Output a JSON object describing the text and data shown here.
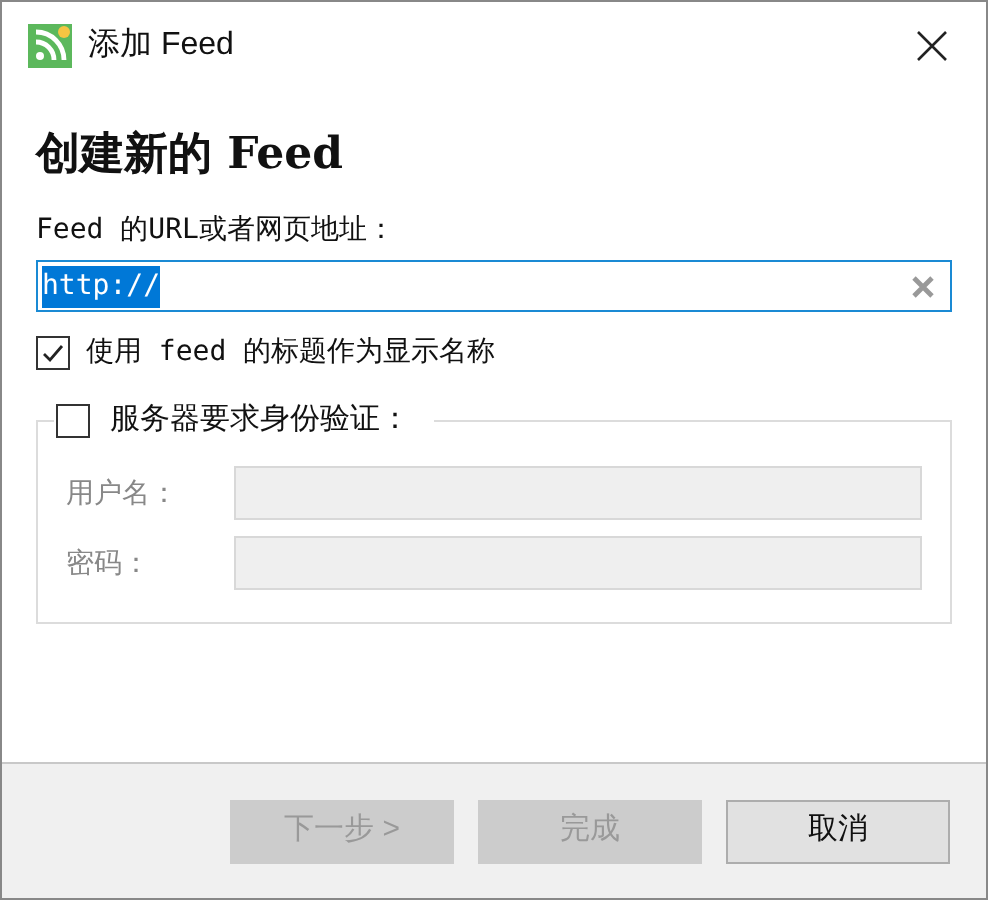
{
  "window": {
    "title": "添加 Feed"
  },
  "heading": "创建新的 Feed",
  "url": {
    "label": "Feed 的URL或者网页地址：",
    "value": "http://",
    "text_selected": true
  },
  "use_feed_title": {
    "label": "使用 feed 的标题作为显示名称",
    "checked": true
  },
  "auth": {
    "label": "服务器要求身份验证：",
    "checked": false,
    "fields": [
      {
        "label": "用户名：",
        "disabled": true
      },
      {
        "label": "密码：",
        "disabled": true
      }
    ]
  },
  "buttons": [
    {
      "label": "下一步 >",
      "disabled": true
    },
    {
      "label": "完成",
      "disabled": true
    },
    {
      "label": "取消",
      "disabled": false
    }
  ]
}
